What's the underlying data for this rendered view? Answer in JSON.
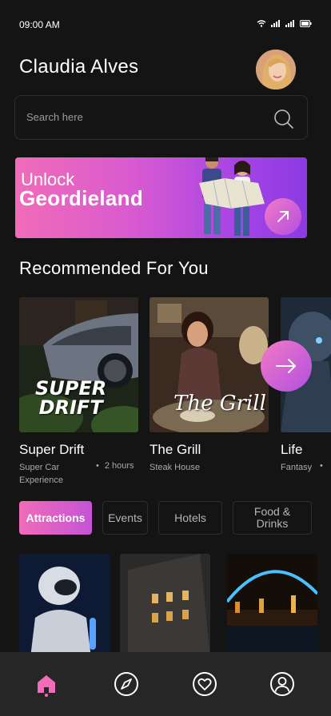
{
  "status_bar": {
    "time": "09:00 AM"
  },
  "header": {
    "user_name": "Claudia Alves"
  },
  "search": {
    "placeholder": "Search here"
  },
  "banner": {
    "line1": "Unlock",
    "line2": "Geordieland"
  },
  "recommended": {
    "title": "Recommended For You",
    "cards": [
      {
        "title": "Super Drift",
        "subtitle": "Super Car Experience",
        "duration": "2 hours",
        "image_text": "SUPER DRIFT"
      },
      {
        "title": "The Grill",
        "subtitle": "Steak House",
        "image_text": "The Grill"
      },
      {
        "title": "Life",
        "subtitle": "Fantasy"
      }
    ]
  },
  "categories": [
    {
      "label": "Attractions",
      "active": true
    },
    {
      "label": "Events",
      "active": false
    },
    {
      "label": "Hotels",
      "active": false
    },
    {
      "label": "Food & Drinks",
      "active": false
    }
  ],
  "nav": {
    "items": [
      {
        "icon": "home-icon",
        "active": true
      },
      {
        "icon": "compass-icon",
        "active": false
      },
      {
        "icon": "heart-icon",
        "active": false
      },
      {
        "icon": "profile-icon",
        "active": false
      }
    ]
  },
  "colors": {
    "accent_pink": "#f06cb8",
    "accent_purple": "#8c3ae4",
    "background": "#141414",
    "nav_background": "#262626"
  }
}
